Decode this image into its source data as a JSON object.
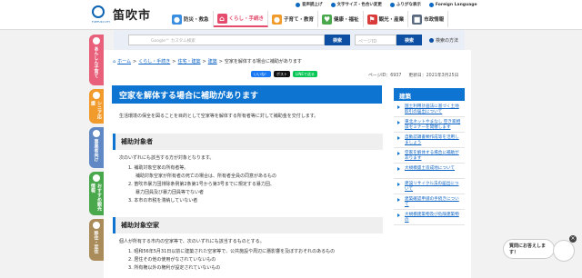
{
  "header": {
    "utility": [
      "音声読上げ",
      "文字サイズ・色合い変更",
      "ふりがな表示",
      "Foreign Language"
    ],
    "logo_text": "笛吹市",
    "logo_sub": "FUEFUKI CITY",
    "nav": [
      {
        "label": "防災・救急",
        "icon": "shield-icon",
        "color": "#3a8ee0"
      },
      {
        "label": "くらし・手続き",
        "icon": "house-icon",
        "color": "#e44b6c"
      },
      {
        "label": "子育て・教育",
        "icon": "child-icon",
        "color": "#f29b2d"
      },
      {
        "label": "健康・福祉",
        "icon": "heart-icon",
        "color": "#49a84b"
      },
      {
        "label": "観光・産業",
        "icon": "flag-icon",
        "color": "#d93b3b"
      },
      {
        "label": "市政情報",
        "icon": "building-icon",
        "color": "#5a6b80"
      }
    ]
  },
  "search": {
    "placeholder": "Google™ カスタム検索",
    "button": "検索",
    "page_id_placeholder": "ページID",
    "page_id_button": "検索",
    "help": "検索の方法"
  },
  "side_tabs": [
    {
      "label": "あんしん子育て",
      "color": "#e8607a"
    },
    {
      "label": "シニア応援",
      "color": "#f29b2d"
    },
    {
      "label": "事業者向け",
      "color": "#5f88c4"
    },
    {
      "label": "おすすめ観光情報",
      "color": "#49a84b"
    },
    {
      "label": "移住・定住",
      "color": "#a98c5a"
    }
  ],
  "breadcrumb": [
    "ホーム",
    "くらし・手続き",
    "住宅・建築",
    "建築",
    "空家を解体する場合に補助があります"
  ],
  "shares": [
    "いいね！",
    "ポスト",
    "LINEで送る"
  ],
  "page_info": {
    "page_id": "ページID：6937",
    "updated": "更新日：2021年3月25日"
  },
  "main": {
    "title": "空家を解体する場合に補助があります",
    "intro": "生活環境の保全を図ることを目的として空家等を解体する所有者等に対して補助金を交付します。",
    "sections": [
      {
        "heading": "補助対象者",
        "lines": [
          "次のいずれにも該当する方が対象となります。",
          "1. 補助対象空家の所有者等。",
          "補助対象空家が所有者の死亡の場合は、所有者全員の同意があるもの",
          "2. 笛吹市暴力団排除条例第2条第1号から第3号までに規定する暴力団、",
          "暴力団員及び暴力団員等でない者",
          "3. 本市の市税を滞納していない者"
        ]
      },
      {
        "heading": "補助対象空家",
        "lines": [
          "個人が所有する市内の空家等で、次のいずれにも該当するものとする。",
          "1. 昭和56年5月31日以前に建築された空家等で、公共施設や周辺に悪影響を及ぼすおそれのあるもの",
          "2. 居住その他の使用がなされていないもの",
          "3. 所有権以外の権利が設定されていないもの"
        ]
      }
    ]
  },
  "related": {
    "heading": "建築",
    "items": [
      "国土利用計画法に基づく土地取引の届出について",
      "東北ネットやまなし 空き家相談セミナーを開催します",
      "自動認識書類作成等を活用しましょう",
      "空家を解体する場合に補助があります",
      "大規模盛土造成地について",
      "建設リサイクル法の届出について",
      "建築確認申請の手続きについて",
      "大規模建築物及び危険建築物の"
    ]
  },
  "chat": {
    "label": "質問にお答えします！"
  }
}
